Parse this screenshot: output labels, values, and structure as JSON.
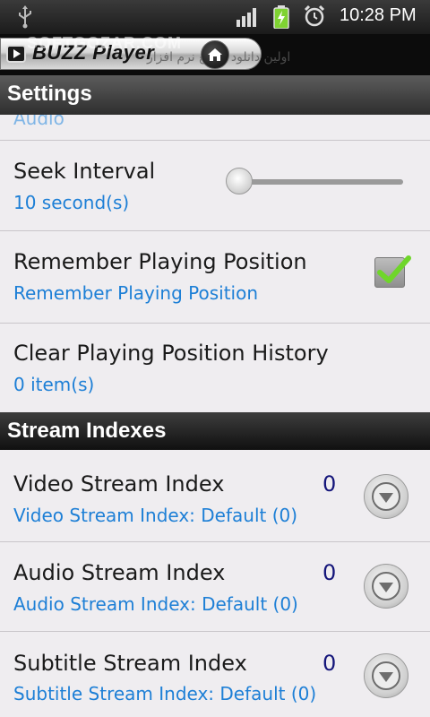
{
  "status_bar": {
    "time": "10:28 PM"
  },
  "app_bar": {
    "app_name": "BUZZ Player",
    "watermark": "SOFTGOZAR.COM",
    "watermark_sub": "اولین دانلود مرجع نرم افزار"
  },
  "settings_section": {
    "header": "Settings",
    "partial_item_summary": "Audio",
    "seek_interval": {
      "title": "Seek Interval",
      "summary": "10 second(s)",
      "slider_fraction": 0.0
    },
    "remember_position": {
      "title": "Remember Playing Position",
      "summary": "Remember Playing Position",
      "checked": true
    },
    "clear_history": {
      "title": "Clear Playing Position History",
      "summary": "0 item(s)"
    }
  },
  "stream_section": {
    "header": "Stream Indexes",
    "items": [
      {
        "title": "Video Stream Index",
        "summary": "Video Stream Index: Default (0)",
        "value": "0"
      },
      {
        "title": "Audio Stream Index",
        "summary": "Audio Stream Index: Default (0)",
        "value": "0"
      },
      {
        "title": "Subtitle Stream Index",
        "summary": "Subtitle Stream Index: Default (0)",
        "value": "0"
      }
    ]
  },
  "colors": {
    "summary_blue": "#1d7fd6",
    "value_navy": "#14157a",
    "check_green": "#6fd62a"
  }
}
